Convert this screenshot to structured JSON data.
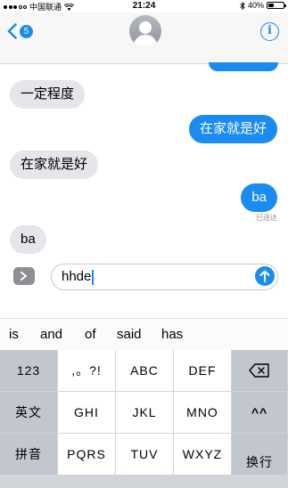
{
  "status_bar": {
    "carrier": "中国联通",
    "time": "21:24",
    "battery": "40%",
    "battery_level": 0.4
  },
  "header": {
    "back_badge": "5",
    "info_label": "i"
  },
  "messages": [
    {
      "side": "in",
      "text": "一定程度"
    },
    {
      "side": "out",
      "text": "在家就是好"
    },
    {
      "side": "in",
      "text": "在家就是好"
    },
    {
      "side": "out",
      "text": "ba"
    },
    {
      "side": "in",
      "text": "ba"
    }
  ],
  "delivery_status": "已送达",
  "composer": {
    "value": "hhde"
  },
  "predictions": [
    "is",
    "and",
    "of",
    "said",
    "has"
  ],
  "keyboard": {
    "row1": [
      "123",
      ",。?!",
      "ABC",
      "DEF"
    ],
    "row2": [
      "英文",
      "GHI",
      "JKL",
      "MNO",
      "^^"
    ],
    "row3": [
      "拼音",
      "PQRS",
      "TUV",
      "WXYZ",
      "换行"
    ]
  },
  "colors": {
    "accent": "#1a8bf0",
    "incoming_bubble": "#e5e5ea",
    "keyboard_bg": "#d1d4d9"
  }
}
